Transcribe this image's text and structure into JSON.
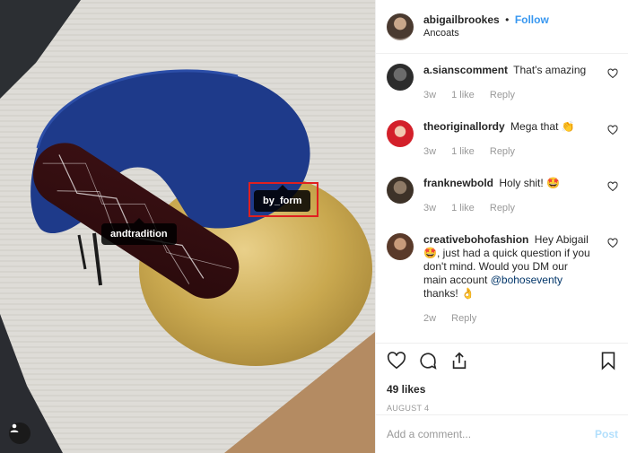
{
  "header": {
    "username": "abigailbrookes",
    "dot": "•",
    "follow_label": "Follow",
    "location": "Ancoats"
  },
  "photo": {
    "tags": [
      "andtradition",
      "by_form"
    ]
  },
  "comments": [
    {
      "username": "a.sianscomment",
      "text": "That's amazing",
      "time": "3w",
      "likes": "1 like",
      "reply": "Reply"
    },
    {
      "username": "theoriginallordy",
      "text": "Mega that 👏",
      "time": "3w",
      "likes": "1 like",
      "reply": "Reply"
    },
    {
      "username": "franknewbold",
      "text": "Holy shit! 🤩",
      "time": "3w",
      "likes": "1 like",
      "reply": "Reply"
    },
    {
      "username": "creativebohofashion",
      "text_before": "Hey Abigail 🤩, just had a quick question if you don't mind. Would you DM our main account ",
      "mention": "@bohoseventy",
      "text_after": " thanks! 👌",
      "time": "2w",
      "reply": "Reply"
    }
  ],
  "actions": {
    "likes": "49 likes",
    "date": "AUGUST 4"
  },
  "add_comment": {
    "placeholder": "Add a comment...",
    "post_label": "Post"
  },
  "colors": {
    "link": "#3897f0",
    "muted": "#999999",
    "highlight_box": "#e02020"
  },
  "icons": [
    "user-tag-icon",
    "heart-icon",
    "comment-icon",
    "share-icon",
    "bookmark-icon"
  ]
}
